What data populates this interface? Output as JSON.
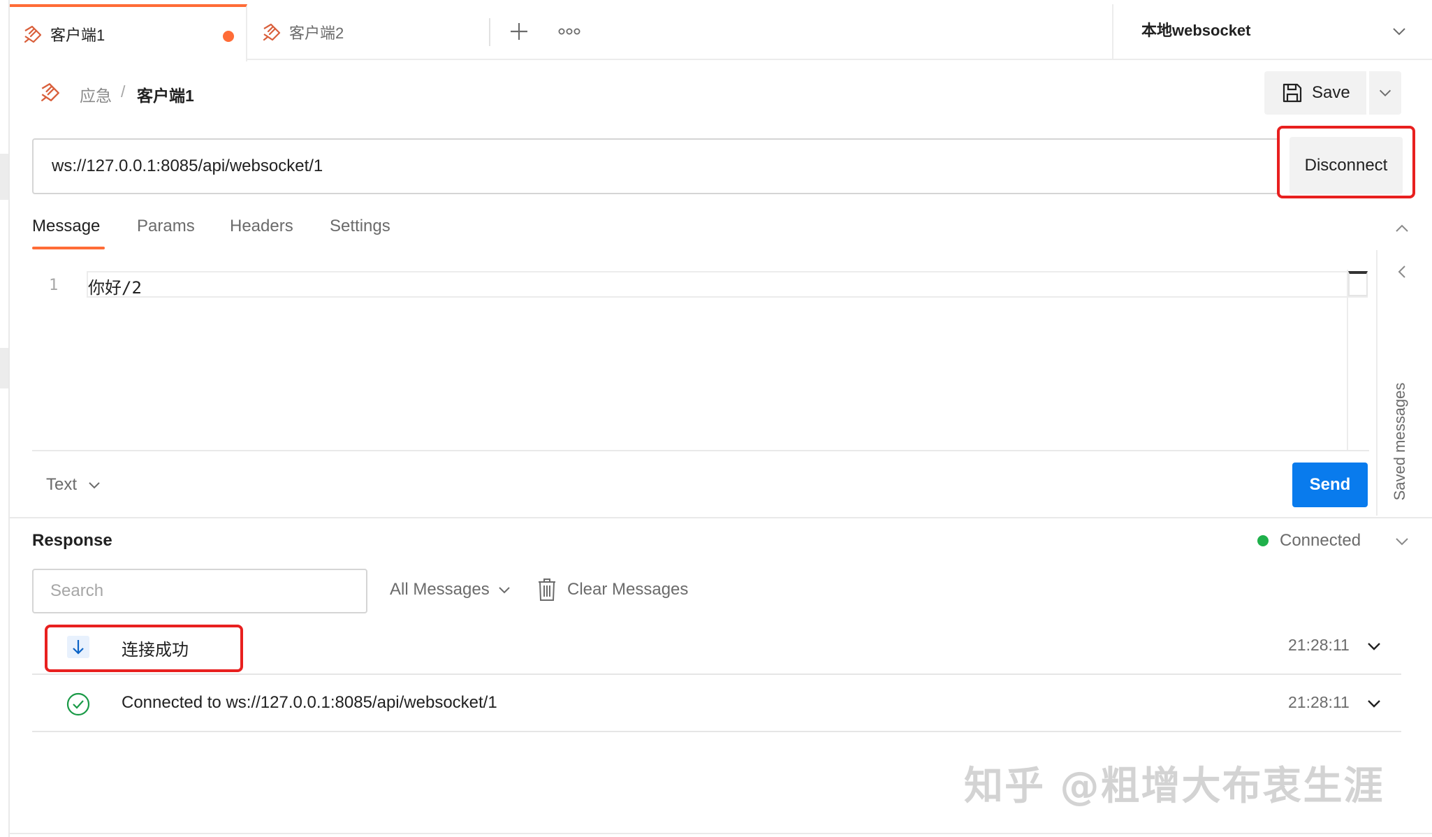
{
  "tabs": [
    {
      "label": "客户端1",
      "active": true,
      "unsaved": true
    },
    {
      "label": "客户端2",
      "active": false,
      "unsaved": false
    }
  ],
  "environment": {
    "name": "本地websocket"
  },
  "breadcrumb": {
    "parent": "应急",
    "separator": "/",
    "current": "客户端1"
  },
  "toolbar": {
    "save_label": "Save"
  },
  "connection": {
    "url": "ws://127.0.0.1:8085/api/websocket/1",
    "disconnect_label": "Disconnect"
  },
  "request_tabs": [
    {
      "label": "Message",
      "active": true
    },
    {
      "label": "Params",
      "active": false
    },
    {
      "label": "Headers",
      "active": false
    },
    {
      "label": "Settings",
      "active": false
    }
  ],
  "editor": {
    "lines": [
      {
        "number": "1",
        "text": "你好/2"
      }
    ],
    "message_type": "Text",
    "send_label": "Send",
    "saved_messages_label": "Saved messages"
  },
  "response": {
    "title": "Response",
    "status": "Connected",
    "status_color": "#1fb04b",
    "search_placeholder": "Search",
    "filter_label": "All Messages",
    "clear_label": "Clear Messages",
    "messages": [
      {
        "direction": "incoming",
        "icon": "arrow-down-icon",
        "text": "连接成功",
        "time": "21:28:11"
      },
      {
        "direction": "system",
        "icon": "check-circle-icon",
        "text": "Connected to ws://127.0.0.1:8085/api/websocket/1",
        "time": "21:28:11"
      }
    ]
  },
  "watermark": "知乎 @粗增大布衷生涯",
  "colors": {
    "accent": "#ff6c37",
    "primary": "#097bed",
    "highlight": "#e8201f",
    "success": "#1fb04b"
  }
}
